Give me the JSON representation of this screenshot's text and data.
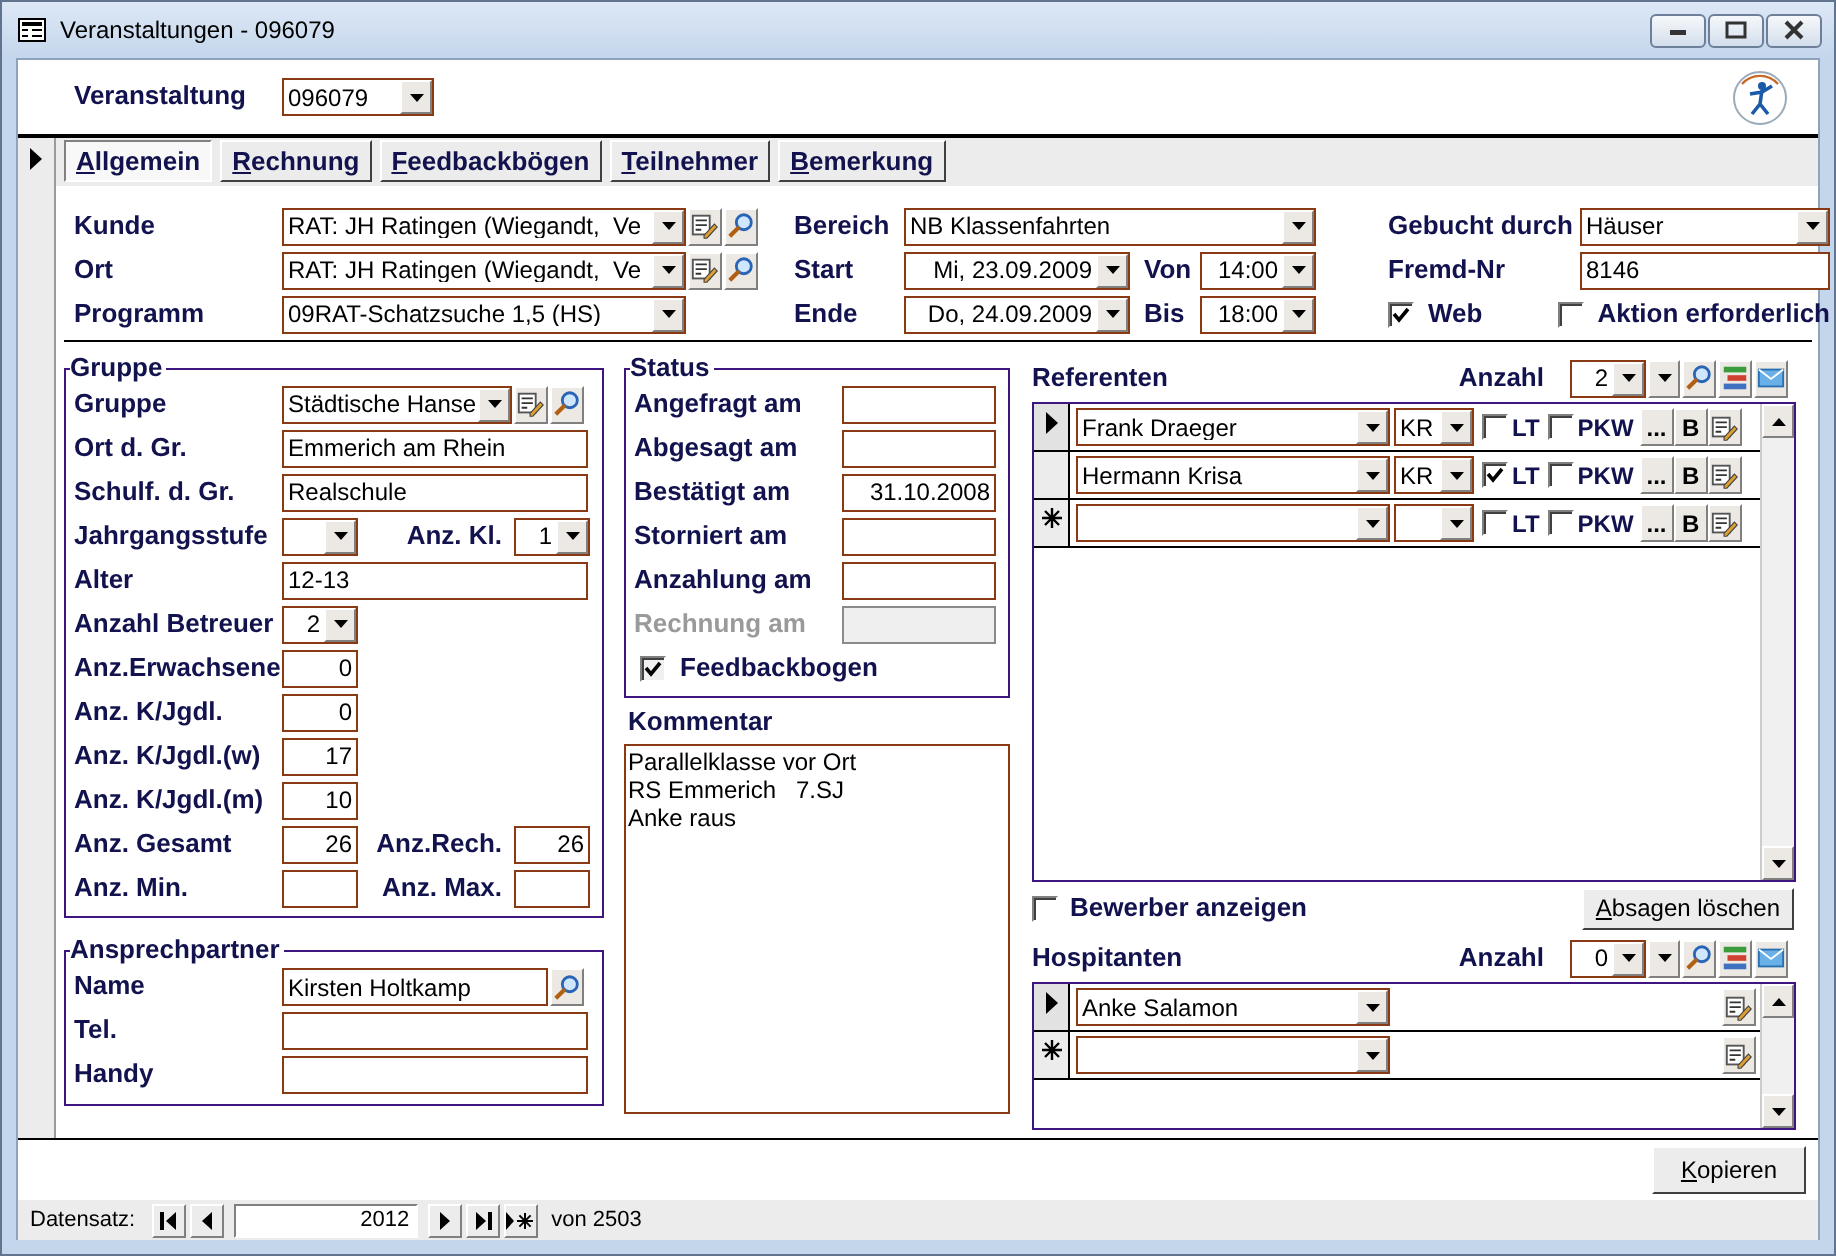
{
  "window": {
    "title": "Veranstaltungen - 096079"
  },
  "header": {
    "label": "Veranstaltung",
    "value": "096079"
  },
  "tabs": [
    {
      "label": "Allgemein",
      "selected": true
    },
    {
      "label": "Rechnung",
      "selected": false
    },
    {
      "label": "Feedbackbögen",
      "selected": false
    },
    {
      "label": "Teilnehmer",
      "selected": false
    },
    {
      "label": "Bemerkung",
      "selected": false
    }
  ],
  "top": {
    "customer": {
      "label": "Kunde",
      "value": "RAT: JH Ratingen (Wiegandt,  Ve"
    },
    "location": {
      "label": "Ort",
      "value": "RAT: JH Ratingen (Wiegandt,  Ve"
    },
    "program": {
      "label": "Programm",
      "value": "09RAT-Schatzsuche 1,5 (HS)"
    },
    "area": {
      "label": "Bereich",
      "value": "NB Klassenfahrten"
    },
    "start": {
      "label": "Start",
      "date": "Mi, 23.09.2009",
      "time_label": "Von",
      "time": "14:00"
    },
    "end": {
      "label": "Ende",
      "date": "Do, 24.09.2009",
      "time_label": "Bis",
      "time": "18:00"
    },
    "booked_by": {
      "label": "Gebucht durch",
      "value": "Häuser"
    },
    "external_no": {
      "label": "Fremd-Nr",
      "value": "8146"
    },
    "web": {
      "label": "Web",
      "checked": true
    },
    "action_required": {
      "label": "Aktion erforderlich",
      "checked": false
    }
  },
  "group": {
    "title": "Gruppe",
    "rows": [
      [
        {
          "label": "Gruppe",
          "value": "Städtische Hanse",
          "kind": "lookup"
        }
      ],
      [
        {
          "label": "Ort d. Gr.",
          "value": "Emmerich am Rhein",
          "kind": "text"
        }
      ],
      [
        {
          "label": "Schulf. d. Gr.",
          "value": "Realschule",
          "kind": "text"
        }
      ],
      [
        {
          "label": "Jahrgangsstufe",
          "kind": "combo"
        },
        {
          "label": "Anz. Kl.",
          "value": "1",
          "kind": "combo"
        }
      ],
      [
        {
          "label": "Alter",
          "value": "12-13",
          "kind": "text"
        }
      ],
      [
        {
          "label": "Anzahl Betreuer",
          "value": "2",
          "kind": "combo"
        }
      ],
      [
        {
          "label": "Anz.Erwachsene",
          "value": "0",
          "kind": "number"
        }
      ],
      [
        {
          "label": "Anz. K/Jgdl.",
          "value": "0",
          "kind": "number"
        }
      ],
      [
        {
          "label": "Anz. K/Jgdl.(w)",
          "value": "17",
          "kind": "number"
        }
      ],
      [
        {
          "label": "Anz. K/Jgdl.(m)",
          "value": "10",
          "kind": "number"
        }
      ],
      [
        {
          "label": "Anz. Gesamt",
          "value": "26",
          "kind": "number"
        },
        {
          "label": "Anz.Rech.",
          "value": "26",
          "kind": "number"
        }
      ],
      [
        {
          "label": "Anz. Min.",
          "kind": "number"
        },
        {
          "label": "Anz. Max.",
          "kind": "number"
        }
      ]
    ]
  },
  "contact": {
    "title": "Ansprechpartner",
    "rows": [
      [
        {
          "label": "Name",
          "value": "Kirsten Holtkamp",
          "kind": "search_text"
        }
      ],
      [
        {
          "label": "Tel.",
          "kind": "text"
        }
      ],
      [
        {
          "label": "Handy",
          "kind": "text"
        }
      ]
    ]
  },
  "status": {
    "title": "Status",
    "rows": [
      {
        "label": "Angefragt am",
        "disabled": false
      },
      {
        "label": "Abgesagt am",
        "disabled": false
      },
      {
        "label": "Bestätigt am",
        "value": "31.10.2008",
        "disabled": false
      },
      {
        "label": "Storniert am",
        "disabled": false
      },
      {
        "label": "Anzahlung am",
        "disabled": false
      },
      {
        "label": "Rechnung am",
        "disabled": true
      }
    ],
    "feedback": {
      "label": "Feedbackbogen",
      "checked": true
    }
  },
  "comment": {
    "label": "Kommentar",
    "text": "Parallelklasse vor Ort\nRS Emmerich   7.SJ\nAnke raus"
  },
  "speakers": {
    "title": "Referenten",
    "count_label": "Anzahl",
    "count": "2",
    "rows": [
      {
        "kind": "record",
        "selected": true,
        "name": "Frank Draeger",
        "role": "KR",
        "lt_label": "LT",
        "lt": false,
        "pkw_label": "PKW",
        "pkw": false,
        "more": "...",
        "b": "B"
      },
      {
        "kind": "record",
        "selected": false,
        "name": "Hermann Krisa",
        "role": "KR",
        "lt_label": "LT",
        "lt": true,
        "pkw_label": "PKW",
        "pkw": false,
        "more": "...",
        "b": "B"
      },
      {
        "kind": "new",
        "selected": false,
        "lt_label": "LT",
        "lt": false,
        "pkw_label": "PKW",
        "pkw": false,
        "more": "...",
        "b": "B"
      }
    ]
  },
  "applicants": {
    "label": "Bewerber anzeigen",
    "checked": false
  },
  "delete_cancellations": "Absagen löschen",
  "guests": {
    "title": "Hospitanten",
    "count_label": "Anzahl",
    "count": "0",
    "rows": [
      {
        "kind": "record",
        "selected": true,
        "name": "Anke Salamon"
      },
      {
        "kind": "new",
        "selected": false
      }
    ]
  },
  "copy_button": "Kopieren",
  "navigation": {
    "label": "Datensatz:",
    "current": "2012",
    "total": "von 2503"
  }
}
